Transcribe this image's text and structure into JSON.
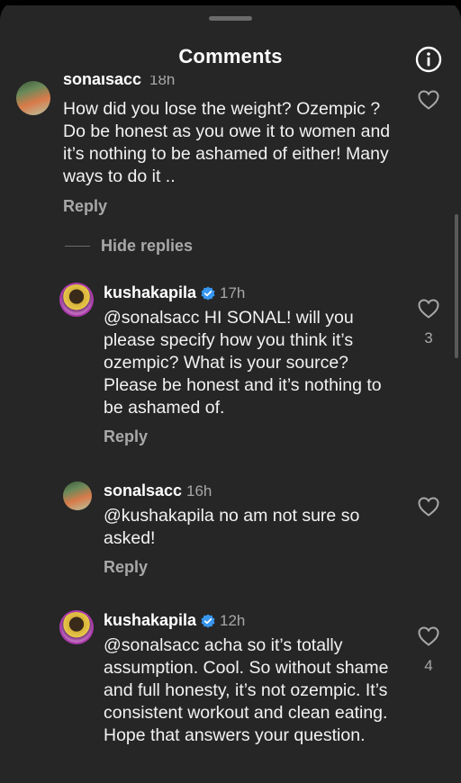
{
  "header": {
    "title": "Comments",
    "info_icon": "info-circle-icon"
  },
  "comments": [
    {
      "username": "sonalsacc",
      "time": "18h",
      "text": "How did you lose the weight? Ozempic ? Do be honest as you owe it to women and it’s nothing to be ashamed of either! Many ways to do it ..",
      "reply_label": "Reply",
      "likes": ""
    }
  ],
  "hide_replies_label": "Hide replies",
  "replies": [
    {
      "username": "kushakapila",
      "verified": true,
      "time": "17h",
      "text": "@sonalsacc HI SONAL! will you please specify how you think it’s ozempic? What is your source? Please be honest and it’s nothing to be ashamed of.",
      "reply_label": "Reply",
      "likes": "3"
    },
    {
      "username": "sonalsacc",
      "verified": false,
      "time": "16h",
      "text": "@kushakapila  no am not sure so asked!",
      "reply_label": "Reply",
      "likes": ""
    },
    {
      "username": "kushakapila",
      "verified": true,
      "time": "12h",
      "text": "@sonalsacc acha so it’s totally assumption. Cool. So without shame and full honesty, it’s not ozempic. It’s consistent workout and clean eating. Hope that answers your question.",
      "reply_label": "",
      "likes": "4"
    }
  ],
  "colors": {
    "background": "#262626",
    "verified_badge": "#3897f0",
    "secondary_text": "#a8a8a8"
  }
}
